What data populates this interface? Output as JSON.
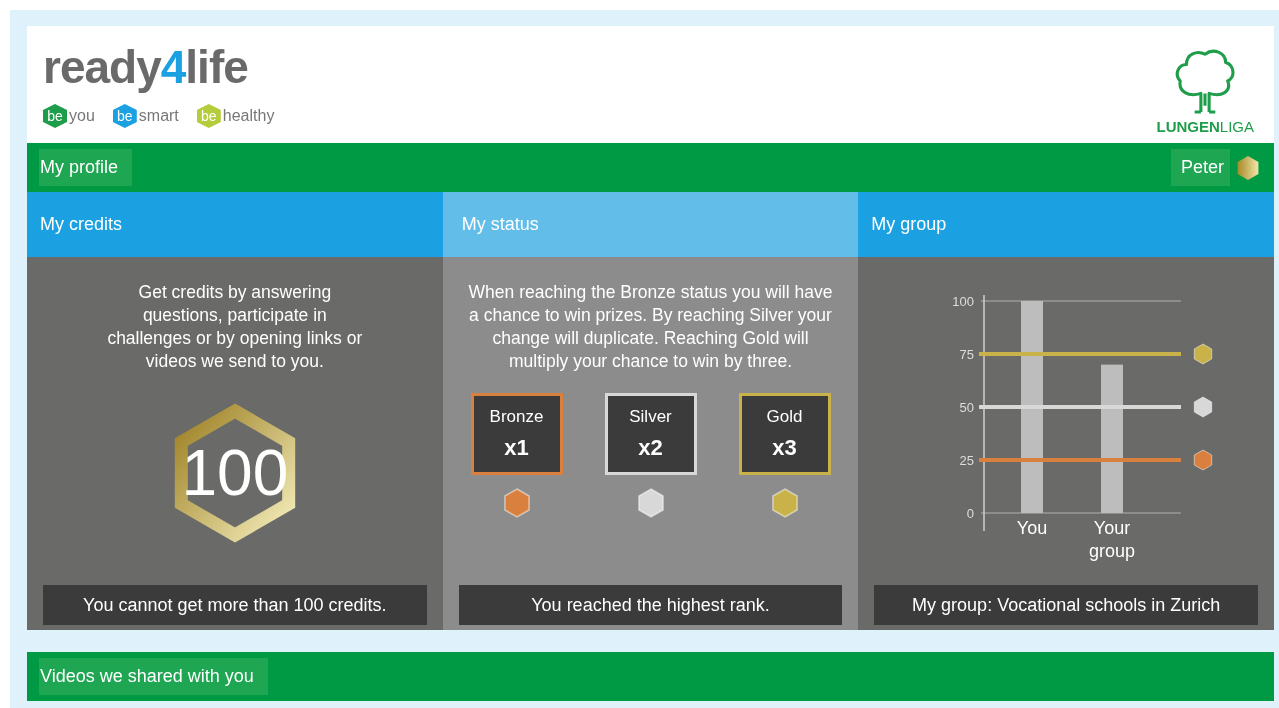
{
  "header": {
    "logo": {
      "before": "ready",
      "mark": "4",
      "after": "life"
    },
    "taglines": [
      {
        "badge": "be",
        "word": "you",
        "color": "#1e9e4a"
      },
      {
        "badge": "be",
        "word": "smart",
        "color": "#1ba1e2"
      },
      {
        "badge": "be",
        "word": "healthy",
        "color": "#b5cc3c"
      }
    ],
    "partner": "**LUNGEN**LIGA"
  },
  "profile_bar": {
    "title": "My profile",
    "user": "Peter"
  },
  "credits": {
    "title": "My credits",
    "text": "Get credits by answering questions, participate in challenges or by opening links or videos we send to you.",
    "value": "100",
    "footer": "You cannot get more than 100 credits."
  },
  "status": {
    "title": "My status",
    "text": "When reaching the Bronze status you will have a chance to win prizes. By reaching Silver your change will duplicate. Reaching Gold will multiply your chance to win by three.",
    "tiers": [
      {
        "label": "Bronze",
        "multiplier": "x1",
        "color": "#d9803f"
      },
      {
        "label": "Silver",
        "multiplier": "x2",
        "color": "#d8d8d8"
      },
      {
        "label": "Gold",
        "multiplier": "x3",
        "color": "#c9b24a"
      }
    ],
    "footer": "You reached the highest rank."
  },
  "group": {
    "title": "My group",
    "chart_data": {
      "type": "bar",
      "categories": [
        "You",
        "Your group"
      ],
      "values": [
        100,
        70
      ],
      "ylim": [
        0,
        100
      ],
      "yticks": [
        0,
        25,
        50,
        75,
        100
      ],
      "ref_lines": [
        {
          "axis": "y",
          "value": 75,
          "color": "#c9b24a"
        },
        {
          "axis": "y",
          "value": 50,
          "color": "#d8d8d8"
        },
        {
          "axis": "y",
          "value": 25,
          "color": "#d9803f"
        }
      ]
    },
    "footer": "My group: Vocational schools in Zurich"
  },
  "videos_bar": {
    "title": "Videos we shared with you"
  }
}
